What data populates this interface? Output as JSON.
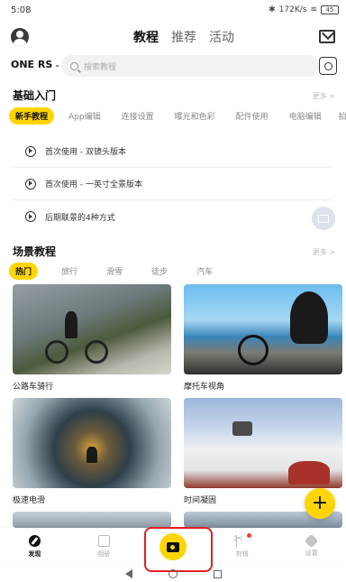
{
  "status_bar": {
    "time": "5:08",
    "network": "172K/s",
    "battery": "45"
  },
  "header": {
    "tabs": [
      {
        "label": "教程",
        "active": true
      },
      {
        "label": "推荐"
      },
      {
        "label": "活动"
      }
    ]
  },
  "search": {
    "device": "ONE RS",
    "placeholder": "搜索教程"
  },
  "basics": {
    "title": "基础入门",
    "more": "更多 >",
    "chips": [
      "新手教程",
      "App编辑",
      "连接设置",
      "曝光和色彩",
      "配件使用",
      "电脑编辑",
      "拍摄教"
    ],
    "guides": [
      "首次使用 - 双镜头版本",
      "首次使用 - 一英寸全景版本",
      "后期联景的4种方式"
    ]
  },
  "scenes": {
    "title": "场景教程",
    "more": "更多 >",
    "chips": [
      "热门",
      "旅行",
      "滑雪",
      "徒步",
      "汽车"
    ],
    "cards": [
      {
        "caption": "公路车骑行"
      },
      {
        "caption": "摩托车视角"
      },
      {
        "caption": "极速电滑"
      },
      {
        "caption": "时间凝固"
      }
    ]
  },
  "bottom_nav": {
    "items": [
      "发现",
      "相册",
      "",
      "剪辑",
      "设置"
    ]
  },
  "colors": {
    "accent": "#ffd500",
    "highlight": "#e02020"
  }
}
